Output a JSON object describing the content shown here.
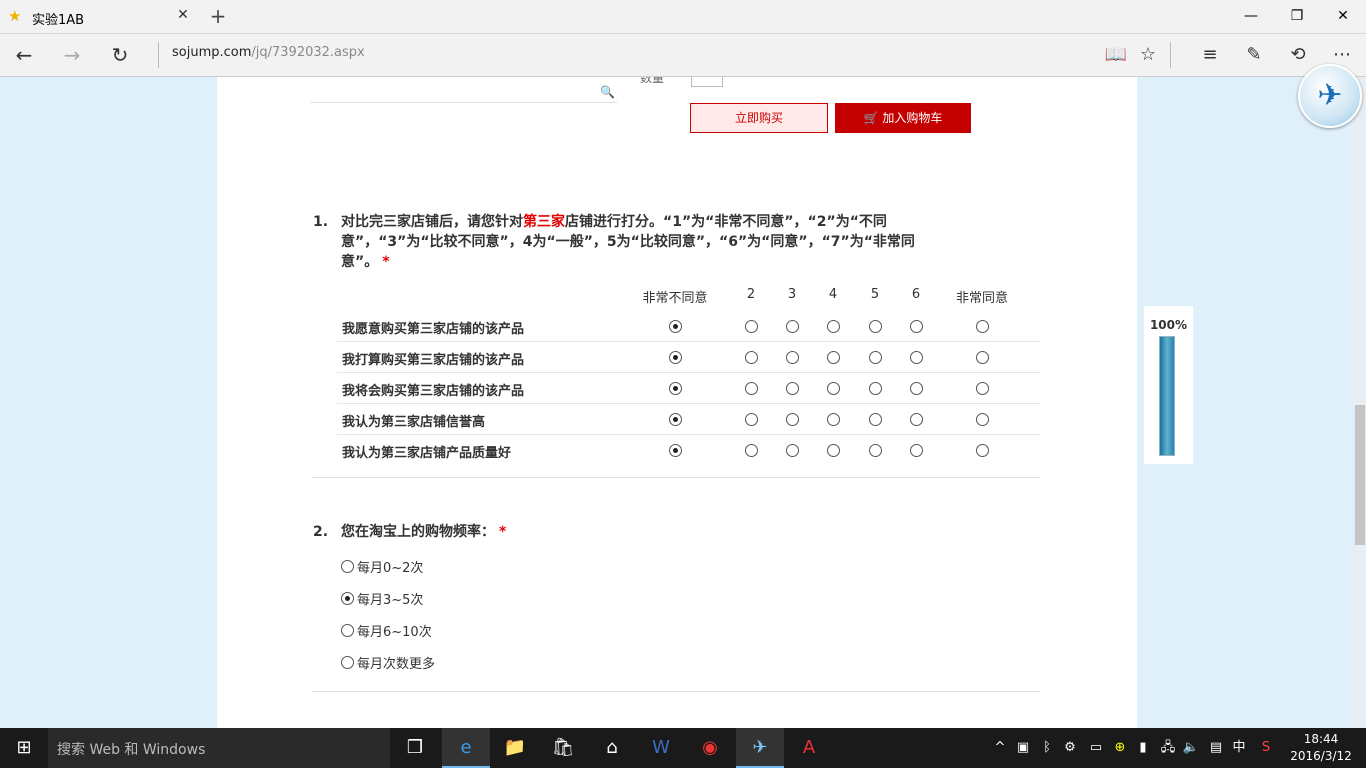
{
  "browser": {
    "tab_title": "实验1AB",
    "url_host": "sojump.com",
    "url_path": "/jq/7392032.aspx"
  },
  "shop": {
    "qty_label": "数量",
    "buy_now": "立即购买",
    "add_cart": "加入购物车"
  },
  "q1": {
    "number": "1.",
    "text_before": "对比完三家店铺后，请您针对",
    "text_highlight": "第三家",
    "text_after": "店铺进行打分。“1”为“非常不同意”，“2”为“不同意”，“3”为“比较不同意”，4为“一般”，5为“比较同意”，“6”为“同意”，“7”为“非常同意”。",
    "line1": "对比完三家店铺后，请您针对",
    "line1_end": "店铺进行打分。“1”为“非常不同意”，“2”为“不同",
    "line2": "意”，“3”为“比较不同意”，4为“一般”，5为“比较同意”，“6”为“同意”，“7”为“非常同",
    "line3": "意”。",
    "required_mark": "*",
    "columns": [
      "非常不同意",
      "2",
      "3",
      "4",
      "5",
      "6",
      "非常同意"
    ],
    "rows": [
      {
        "label": "我愿意购买第三家店铺的该产品",
        "selected": 0
      },
      {
        "label": "我打算购买第三家店铺的该产品",
        "selected": 0
      },
      {
        "label": "我将会购买第三家店铺的该产品",
        "selected": 0
      },
      {
        "label": "我认为第三家店铺信誉高",
        "selected": 0
      },
      {
        "label": "我认为第三家店铺产品质量好",
        "selected": 0
      }
    ]
  },
  "q2": {
    "number": "2.",
    "text": "您在淘宝上的购物频率：",
    "required_mark": "*",
    "options": [
      "每月0~2次",
      "每月3~5次",
      "每月6~10次",
      "每月次数更多"
    ],
    "selected": 1
  },
  "progress": {
    "label": "100%",
    "value": 1.0
  },
  "taskbar": {
    "search_placeholder": "搜索 Web 和 Windows",
    "ime": "中",
    "time": "18:44",
    "date": "2016/3/12"
  }
}
